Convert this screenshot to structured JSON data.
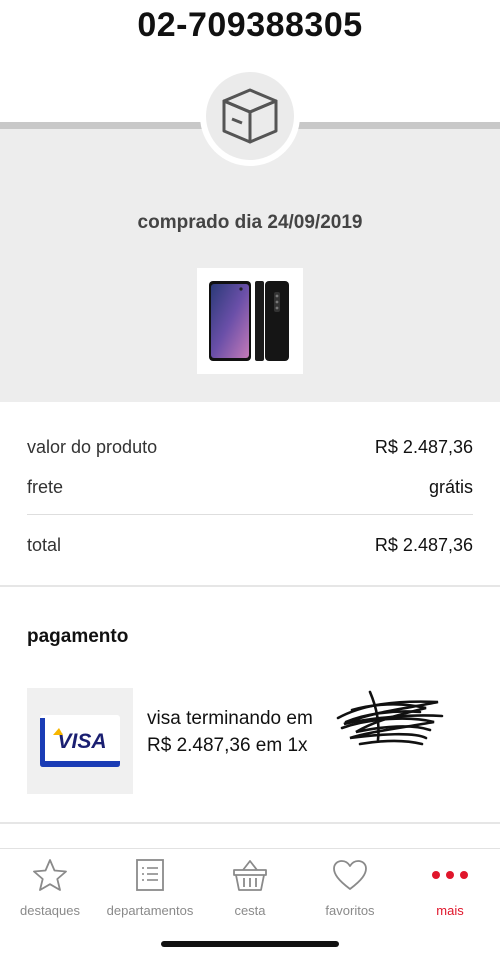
{
  "order": {
    "number": "02-709388305"
  },
  "hero": {
    "purchased_label": "comprado dia 24/09/2019",
    "icon": "package-box-icon"
  },
  "summary": {
    "product_value_label": "valor do produto",
    "product_value": "R$ 2.487,36",
    "shipping_label": "frete",
    "shipping_value": "grátis",
    "total_label": "total",
    "total_value": "R$ 2.487,36"
  },
  "payment": {
    "title": "pagamento",
    "card_brand": "VISA",
    "card_line": "visa terminando em",
    "amount_line": "R$ 2.487,36 em 1x"
  },
  "tabs": [
    {
      "label": "destaques",
      "icon": "star-icon",
      "active": false
    },
    {
      "label": "departamentos",
      "icon": "list-icon",
      "active": false
    },
    {
      "label": "cesta",
      "icon": "basket-icon",
      "active": false
    },
    {
      "label": "favoritos",
      "icon": "heart-icon",
      "active": false
    },
    {
      "label": "mais",
      "icon": "more-dots-icon",
      "active": true
    }
  ],
  "colors": {
    "accent": "#e0162b",
    "visa_blue": "#1a1f71",
    "visa_gold": "#f7b600",
    "hero_bg": "#ededed"
  }
}
